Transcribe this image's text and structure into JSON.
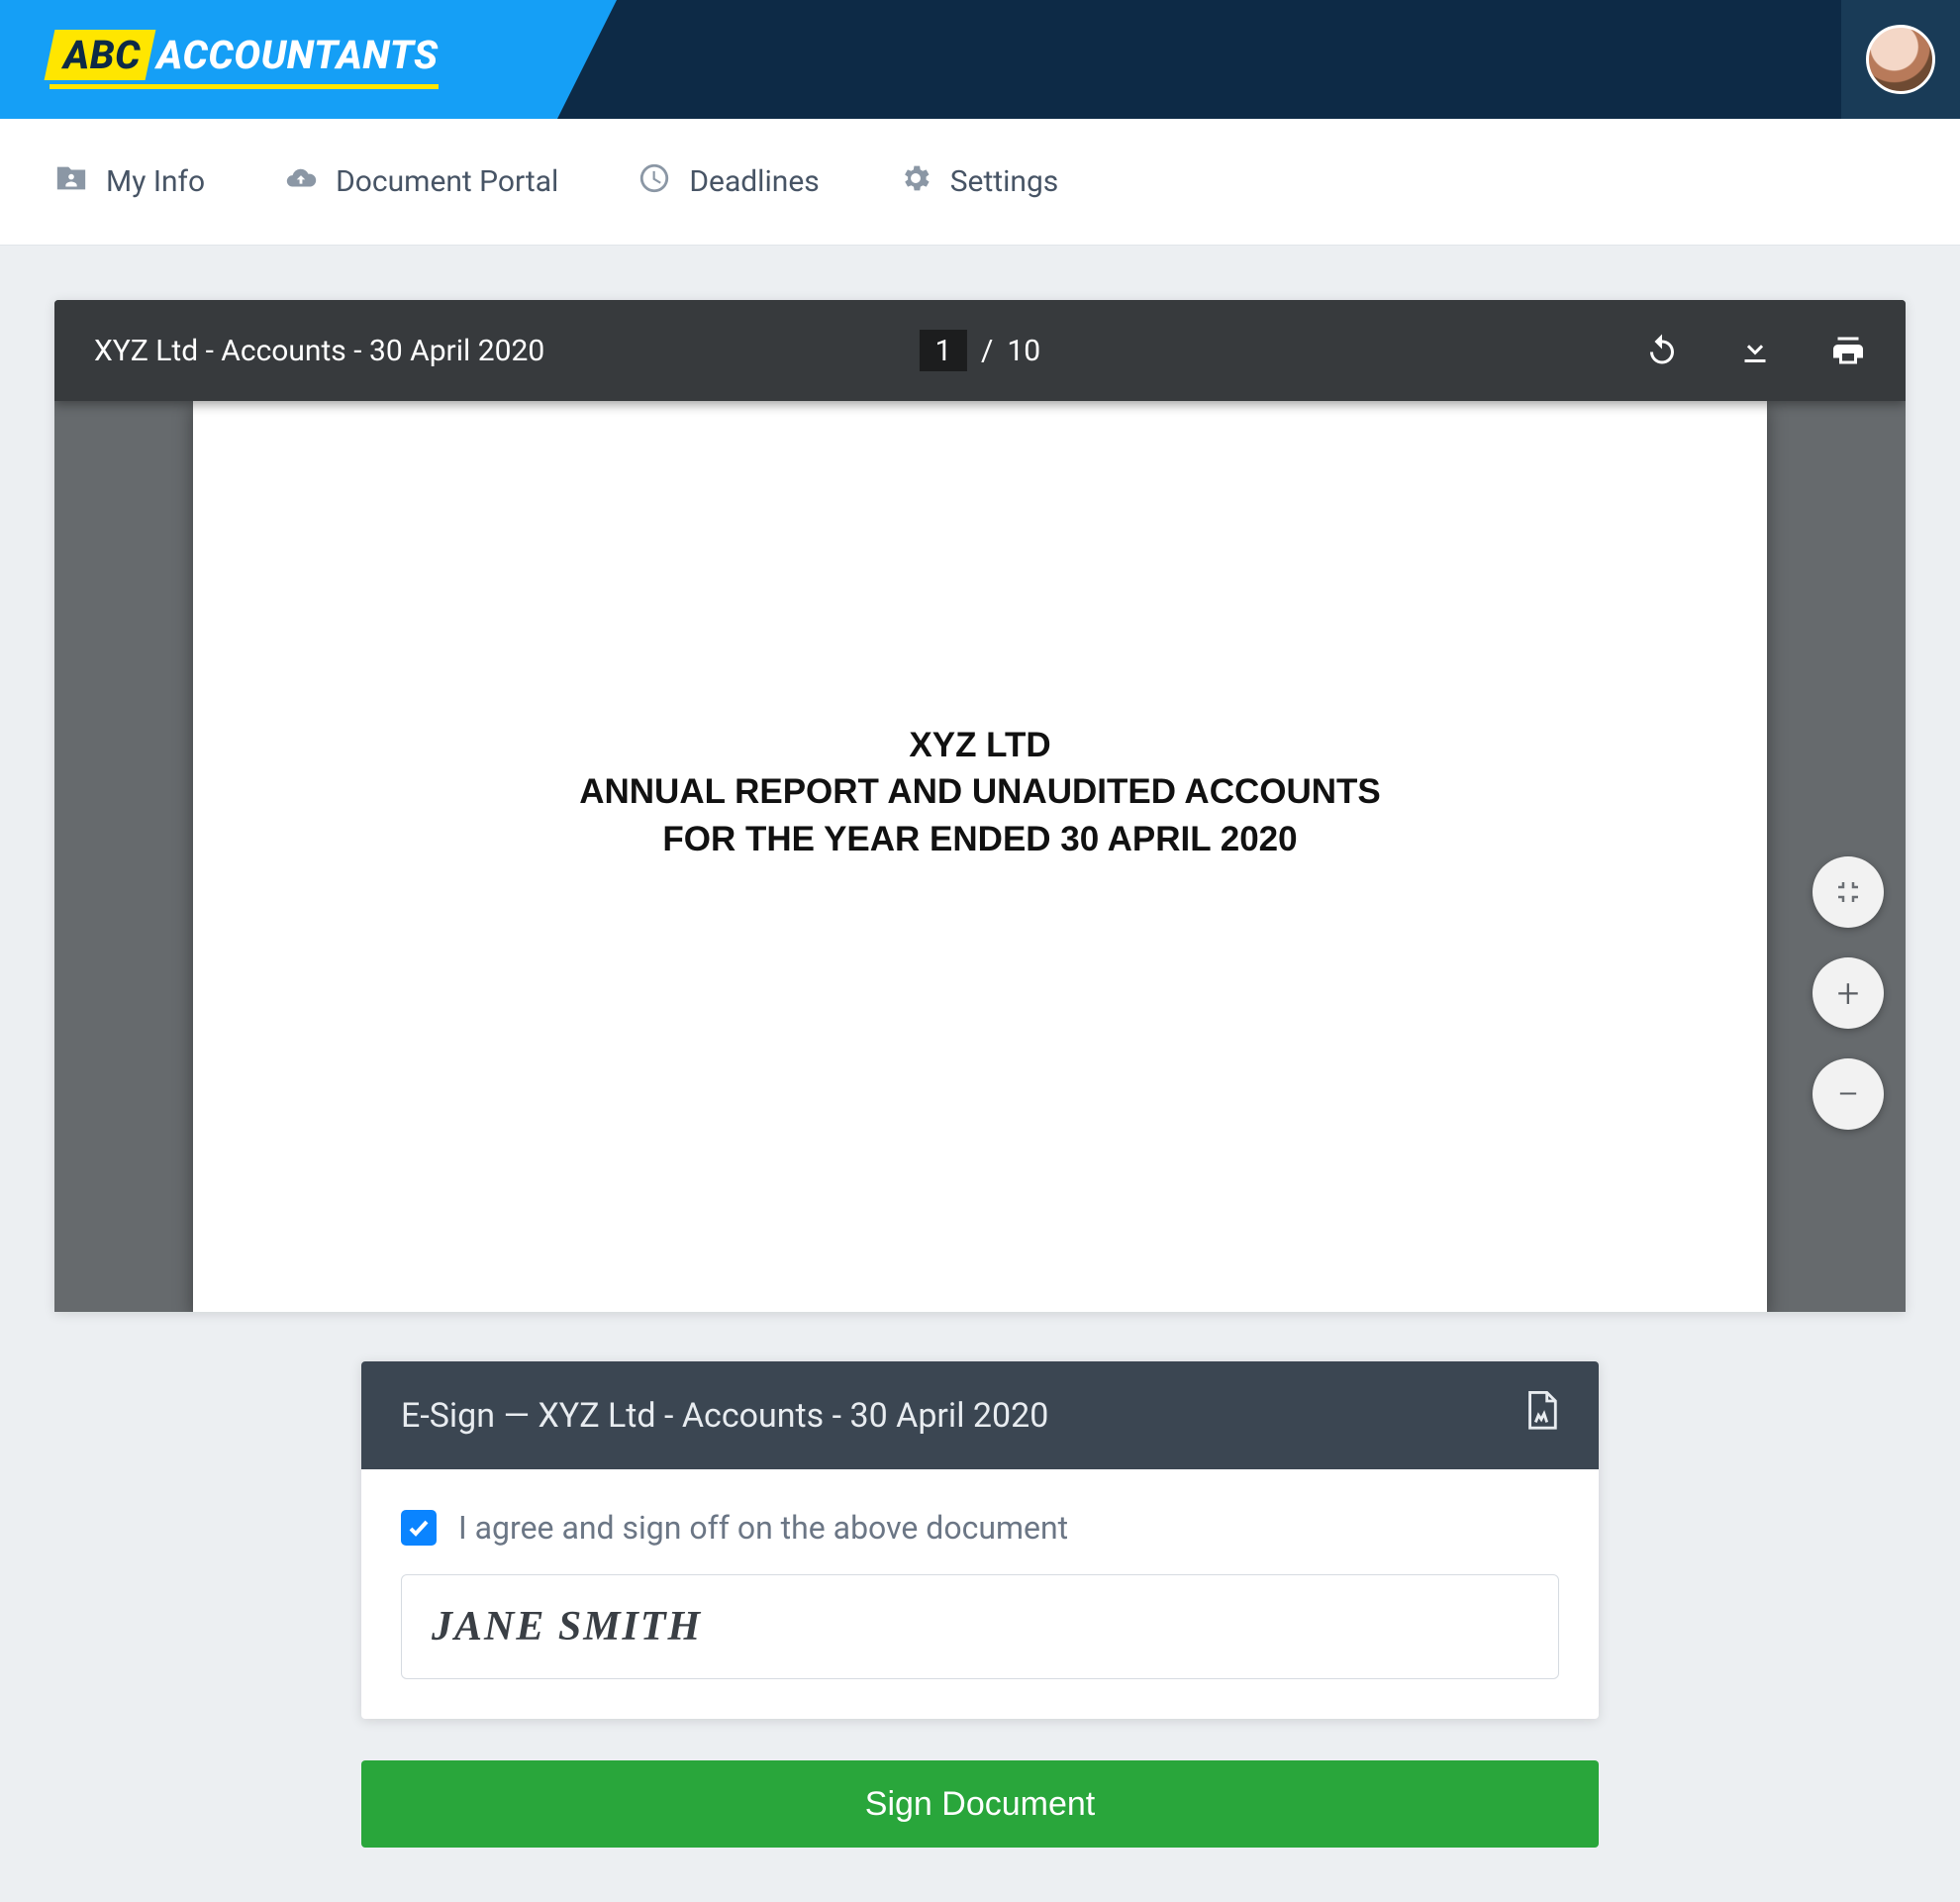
{
  "brand": {
    "abc": "ABC",
    "rest": "ACCOUNTANTS"
  },
  "nav": {
    "my_info": "My Info",
    "doc_portal": "Document Portal",
    "deadlines": "Deadlines",
    "settings": "Settings"
  },
  "viewer": {
    "title": "XYZ Ltd - Accounts - 30 April 2020",
    "page_current": "1",
    "page_sep": "/",
    "page_total": "10",
    "doc_line1": "XYZ LTD",
    "doc_line2": "ANNUAL REPORT AND UNAUDITED ACCOUNTS",
    "doc_line3": "FOR THE YEAR ENDED 30 APRIL 2020"
  },
  "esign": {
    "header": "E-Sign — XYZ Ltd - Accounts - 30 April 2020",
    "consent_label": "I agree and sign off on the above document",
    "signature_value": "JANE SMITH",
    "button_label": "Sign Document",
    "consent_checked": true
  }
}
